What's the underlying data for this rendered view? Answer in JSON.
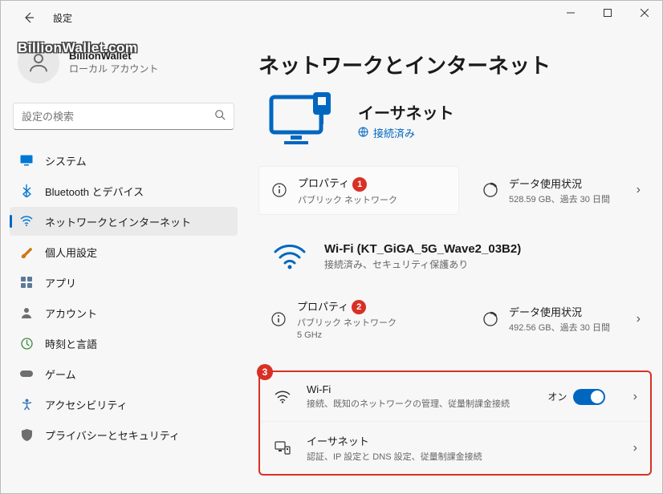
{
  "app_title": "設定",
  "user": {
    "name": "BillionWallet",
    "sub": "ローカル アカウント",
    "watermark": "BillionWallet.com"
  },
  "search": {
    "placeholder": "設定の検索"
  },
  "nav": [
    {
      "label": "システム"
    },
    {
      "label": "Bluetooth とデバイス"
    },
    {
      "label": "ネットワークとインターネット"
    },
    {
      "label": "個人用設定"
    },
    {
      "label": "アプリ"
    },
    {
      "label": "アカウント"
    },
    {
      "label": "時刻と言語"
    },
    {
      "label": "ゲーム"
    },
    {
      "label": "アクセシビリティ"
    },
    {
      "label": "プライバシーとセキュリティ"
    }
  ],
  "page": {
    "title": "ネットワークとインターネット"
  },
  "hero": {
    "title": "イーサネット",
    "status": "接続済み"
  },
  "eth": {
    "prop": {
      "title": "プロパティ",
      "sub": "パブリック ネットワーク",
      "badge": "1"
    },
    "data": {
      "title": "データ使用状況",
      "sub": "528.59 GB、過去 30 日間"
    }
  },
  "wifi": {
    "name": "Wi-Fi (KT_GiGA_5G_Wave2_03B2)",
    "sub": "接続済み、セキュリティ保護あり",
    "prop": {
      "title": "プロパティ",
      "sub": "パブリック ネットワーク",
      "sub2": "5 GHz",
      "badge": "2"
    },
    "data": {
      "title": "データ使用状況",
      "sub": "492.56 GB、過去 30 日間"
    }
  },
  "list": {
    "badge": "3",
    "items": [
      {
        "title": "Wi-Fi",
        "sub": "接続、既知のネットワークの管理、従量制課金接続",
        "on": "オン"
      },
      {
        "title": "イーサネット",
        "sub": "認証、IP 設定と DNS 設定、従量制課金接続"
      }
    ]
  }
}
